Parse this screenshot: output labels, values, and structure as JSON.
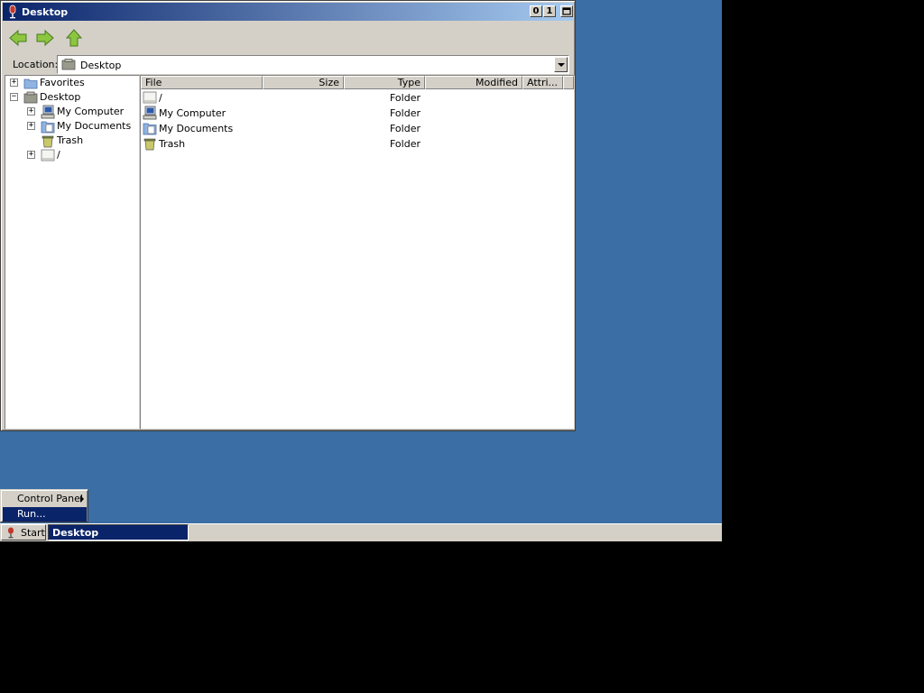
{
  "window": {
    "title": "Desktop",
    "buttons": {
      "minimize": "0",
      "restore": "1"
    }
  },
  "toolbar": {
    "back": "back-arrow-icon",
    "forward": "forward-arrow-icon",
    "up": "up-arrow-icon"
  },
  "location": {
    "label": "Location:",
    "value": "Desktop"
  },
  "tree": {
    "items": [
      {
        "label": "Favorites",
        "toggle": "+",
        "icon": "folder-icon"
      },
      {
        "label": "Desktop",
        "toggle": "−",
        "icon": "desktop-icon"
      },
      {
        "label": "My Computer",
        "toggle": "+",
        "icon": "computer-icon"
      },
      {
        "label": "My Documents",
        "toggle": "+",
        "icon": "documents-icon"
      },
      {
        "label": "Trash",
        "toggle": "",
        "icon": "trash-icon"
      },
      {
        "label": "/",
        "toggle": "+",
        "icon": "drive-icon"
      }
    ]
  },
  "file_list": {
    "columns": [
      "File",
      "Size",
      "Type",
      "Modified",
      "Attri..."
    ],
    "rows": [
      {
        "name": "/",
        "type": "Folder",
        "icon": "drive-icon"
      },
      {
        "name": "My Computer",
        "type": "Folder",
        "icon": "computer-icon"
      },
      {
        "name": "My Documents",
        "type": "Folder",
        "icon": "documents-icon"
      },
      {
        "name": "Trash",
        "type": "Folder",
        "icon": "trash-icon"
      }
    ]
  },
  "start_menu": {
    "items": [
      "Control Panel",
      "Run..."
    ]
  },
  "taskbar": {
    "start_label": "Start",
    "tasks": [
      "Desktop"
    ]
  },
  "colors": {
    "desktop_bg": "#3a6ea5",
    "titlebar_start": "#0a246a",
    "titlebar_end": "#a6caf0",
    "selection": "#0a246a",
    "face": "#d4d0c8"
  }
}
